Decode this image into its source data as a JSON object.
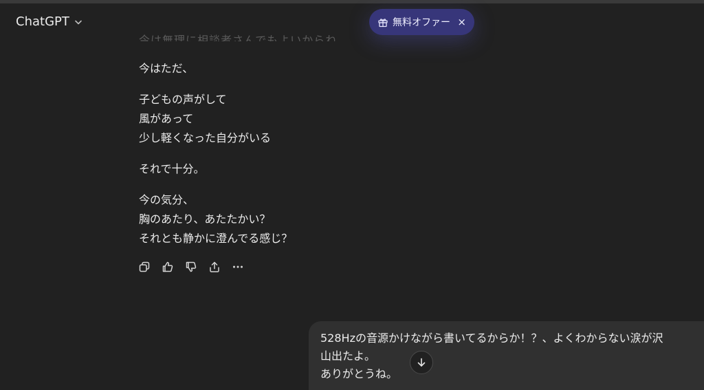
{
  "header": {
    "model_name": "ChatGPT",
    "model_chevron_icon": "chevron-down-icon"
  },
  "offer": {
    "icon": "gift-icon",
    "label": "無料オファー",
    "close_glyph": "×"
  },
  "faded_previous_line": "今は無理に相談者さんでもよいからね",
  "assistant": {
    "paragraphs": [
      [
        "今はただ、"
      ],
      [
        "子どもの声がして",
        "風があって",
        "少し軽くなった自分がいる"
      ],
      [
        "それで十分。"
      ],
      [
        "今の気分、",
        "胸のあたり、あたたかい？",
        "それとも静かに澄んでる感じ？"
      ]
    ],
    "actions": [
      "copy-icon",
      "thumbs-up-icon",
      "thumbs-down-icon",
      "share-icon",
      "more-icon"
    ]
  },
  "user_message": {
    "lines": [
      "528Hzの音源かけながら書いてるからか！？、よくわからない涙が沢",
      "山出たよ。",
      "ありがとうね。"
    ]
  },
  "scroll_button_icon": "arrow-down-icon",
  "colors": {
    "background": "#212121",
    "bubble": "#303030",
    "offer_pill": "#37367a",
    "text": "#ececec"
  }
}
